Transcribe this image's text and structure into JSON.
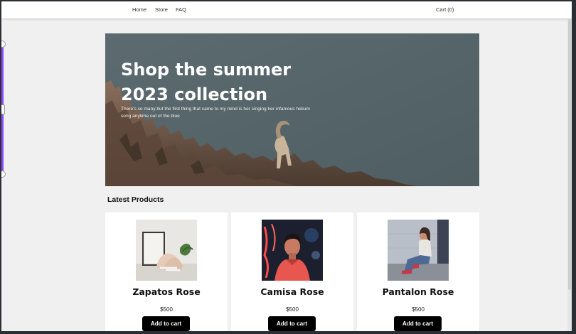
{
  "nav": {
    "home": "Home",
    "store": "Store",
    "faq": "FAQ",
    "cart": "Cart (0)"
  },
  "hero": {
    "title": "Shop the summer 2023 collection",
    "subtitle": "There's so many but the first thing that came to my mind is her singing her infamous helium song anytime out of the blue",
    "background_color": "#56666a"
  },
  "products_section": {
    "title": "Latest Products",
    "products": [
      {
        "name": "Zapatos Rose",
        "price": "$500",
        "button_label": "Add to cart",
        "image": "sneakers-photo"
      },
      {
        "name": "Camisa Rose",
        "price": "$500",
        "button_label": "Add to cart",
        "image": "man-neon-shirt-photo"
      },
      {
        "name": "Pantalon Rose",
        "price": "$500",
        "button_label": "Add to cart",
        "image": "woman-jeans-photo"
      }
    ]
  },
  "colors": {
    "page_background": "#f0f0f0",
    "button_background": "#000000",
    "accent_left": "#8a4dff"
  }
}
